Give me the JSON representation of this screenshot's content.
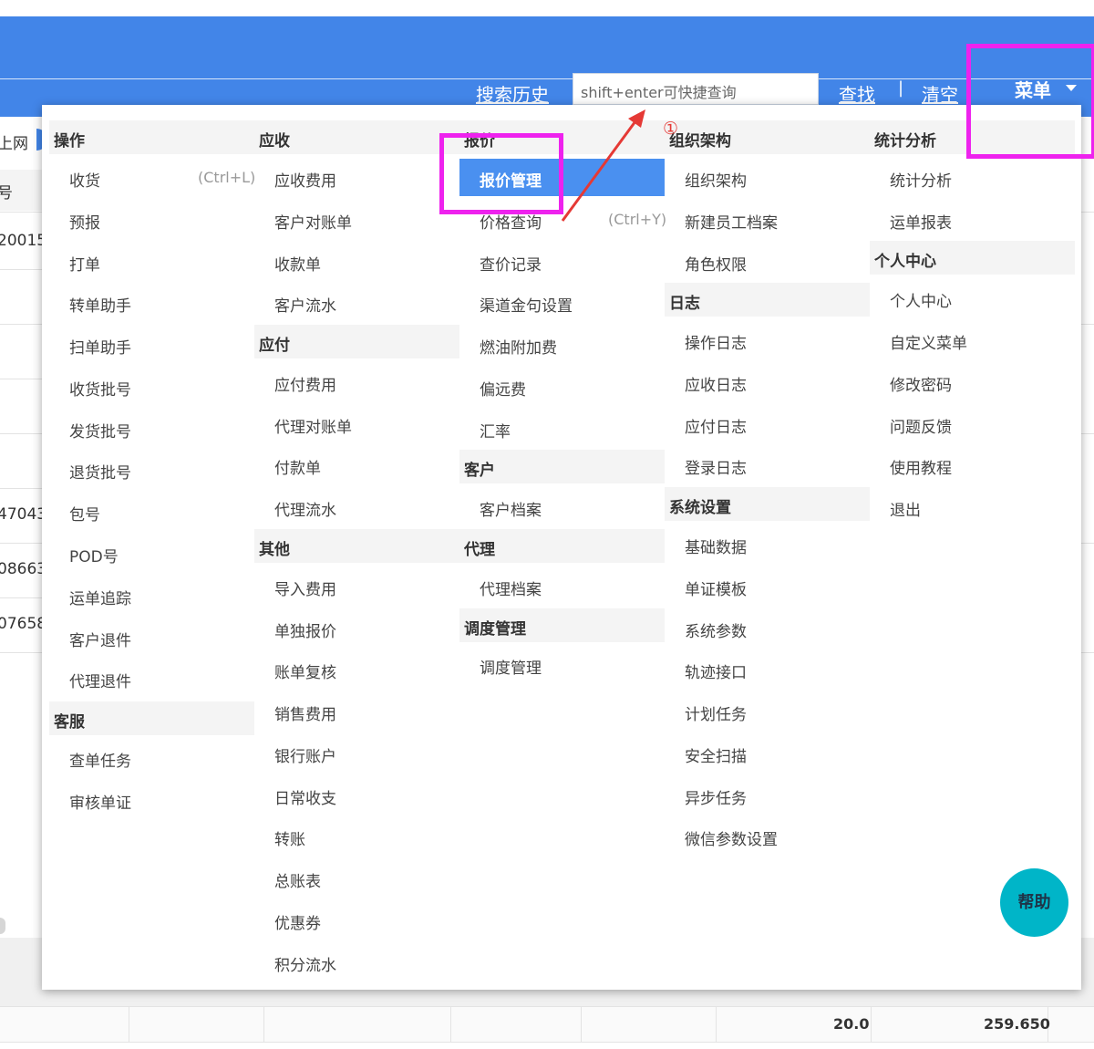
{
  "header": {
    "search_history": "搜索历史",
    "search_placeholder": "shift+enter可快捷查询",
    "find_label": "查找",
    "separator": "|",
    "clear_label": "清空",
    "menu_label": "菜单"
  },
  "background": {
    "row_texts": [
      "上网",
      "号",
      "20015",
      "47043",
      "08663",
      "07658"
    ],
    "footer_values": [
      "20.0",
      "259.650"
    ]
  },
  "menu": {
    "sections": {
      "ops": "操作",
      "cs": "客服",
      "recv": "应收",
      "pay": "应付",
      "other": "其他",
      "quote": "报价",
      "customer": "客户",
      "agent": "代理",
      "dispatch": "调度管理",
      "org": "组织架构",
      "log": "日志",
      "sys": "系统设置",
      "stats": "统计分析",
      "personal": "个人中心"
    },
    "ops_items": [
      "收货",
      "预报",
      "打单",
      "转单助手",
      "扫单助手",
      "收货批号",
      "发货批号",
      "退货批号",
      "包号",
      "POD号",
      "运单追踪",
      "客户退件",
      "代理退件"
    ],
    "ops_shortcut": "(Ctrl+L)",
    "cs_items": [
      "查单任务",
      "审核单证"
    ],
    "recv_items": [
      "应收费用",
      "客户对账单",
      "收款单",
      "客户流水"
    ],
    "pay_items": [
      "应付费用",
      "代理对账单",
      "付款单",
      "代理流水"
    ],
    "other_items": [
      "导入费用",
      "单独报价",
      "账单复核",
      "销售费用",
      "银行账户",
      "日常收支",
      "转账",
      "总账表",
      "优惠券",
      "积分流水"
    ],
    "quote_active": "报价管理",
    "quote_items": [
      "价格查询",
      "查价记录",
      "渠道金句设置",
      "燃油附加费",
      "偏远费",
      "汇率"
    ],
    "quote_shortcut": "(Ctrl+Y)",
    "customer_items": [
      "客户档案"
    ],
    "agent_items": [
      "代理档案"
    ],
    "dispatch_items": [
      "调度管理"
    ],
    "org_items": [
      "组织架构",
      "新建员工档案",
      "角色权限"
    ],
    "log_items": [
      "操作日志",
      "应收日志",
      "应付日志",
      "登录日志"
    ],
    "sys_items": [
      "基础数据",
      "单证模板",
      "系统参数",
      "轨迹接口",
      "计划任务",
      "安全扫描",
      "异步任务",
      "微信参数设置"
    ],
    "stats_items": [
      "统计分析",
      "运单报表"
    ],
    "personal_items": [
      "个人中心",
      "自定义菜单",
      "修改密码",
      "问题反馈",
      "使用教程",
      "退出"
    ]
  },
  "annotation": {
    "step": "①",
    "color": "#ee22ee",
    "arrow_color": "#e53935"
  },
  "help_label": "帮助",
  "colors": {
    "accent": "#4285e8",
    "active_item": "#4a90f0",
    "help": "#00b5c8"
  }
}
